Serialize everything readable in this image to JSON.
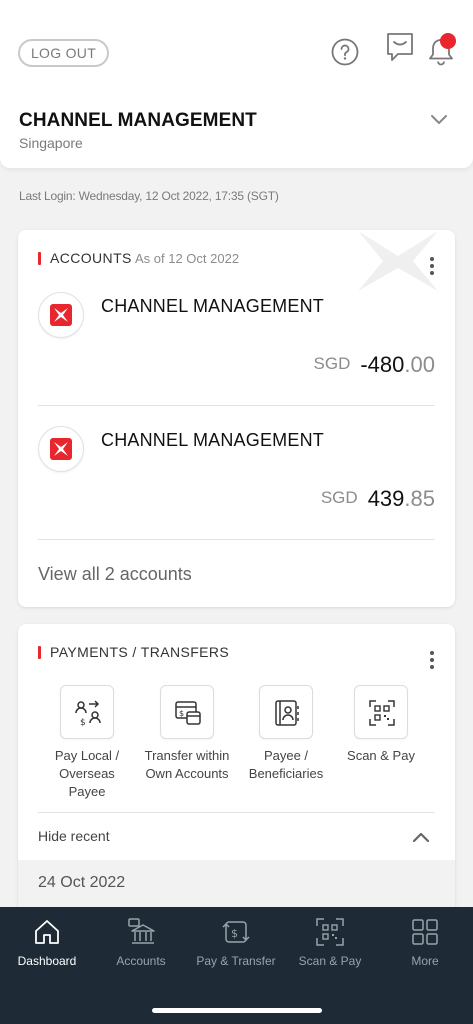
{
  "header": {
    "logout_label": "LOG OUT",
    "icons": [
      "help-icon",
      "chat-icon",
      "bell-icon"
    ],
    "notification_dot_color": "#e8262d"
  },
  "profile": {
    "name": "CHANNEL MANAGEMENT",
    "country": "Singapore"
  },
  "last_login": "Last Login: Wednesday, 12 Oct 2022, 17:35 (SGT)",
  "accounts": {
    "title": "ACCOUNTS",
    "as_of": "As of 12 Oct 2022",
    "items": [
      {
        "name": "CHANNEL MANAGEMENT",
        "currency": "SGD",
        "amount_whole": "-480",
        "amount_decimal": ".00"
      },
      {
        "name": "CHANNEL MANAGEMENT",
        "currency": "SGD",
        "amount_whole": "439",
        "amount_decimal": ".85"
      }
    ],
    "view_all": "View all 2 accounts"
  },
  "payments": {
    "title": "PAYMENTS / TRANSFERS",
    "tiles": [
      {
        "label": "Pay Local / Overseas Payee",
        "icon": "pay-local-icon"
      },
      {
        "label": "Transfer within Own Accounts",
        "icon": "transfer-icon"
      },
      {
        "label": "Payee / Beneficiaries",
        "icon": "payee-book-icon"
      },
      {
        "label": "Scan & Pay",
        "icon": "qr-scan-icon"
      }
    ],
    "hide_recent": "Hide recent",
    "recent_date": "24 Oct 2022"
  },
  "bottom_nav": [
    {
      "label": "Dashboard",
      "icon": "home-icon",
      "active": true
    },
    {
      "label": "Accounts",
      "icon": "bank-icon",
      "active": false
    },
    {
      "label": "Pay & Transfer",
      "icon": "pay-transfer-icon",
      "active": false
    },
    {
      "label": "Scan & Pay",
      "icon": "qr-scan-icon",
      "active": false
    },
    {
      "label": "More",
      "icon": "grid-icon",
      "active": false
    }
  ],
  "colors": {
    "accent_red": "#e8262d",
    "nav_background": "#1e2a35",
    "page_background": "#f2f2f2"
  }
}
